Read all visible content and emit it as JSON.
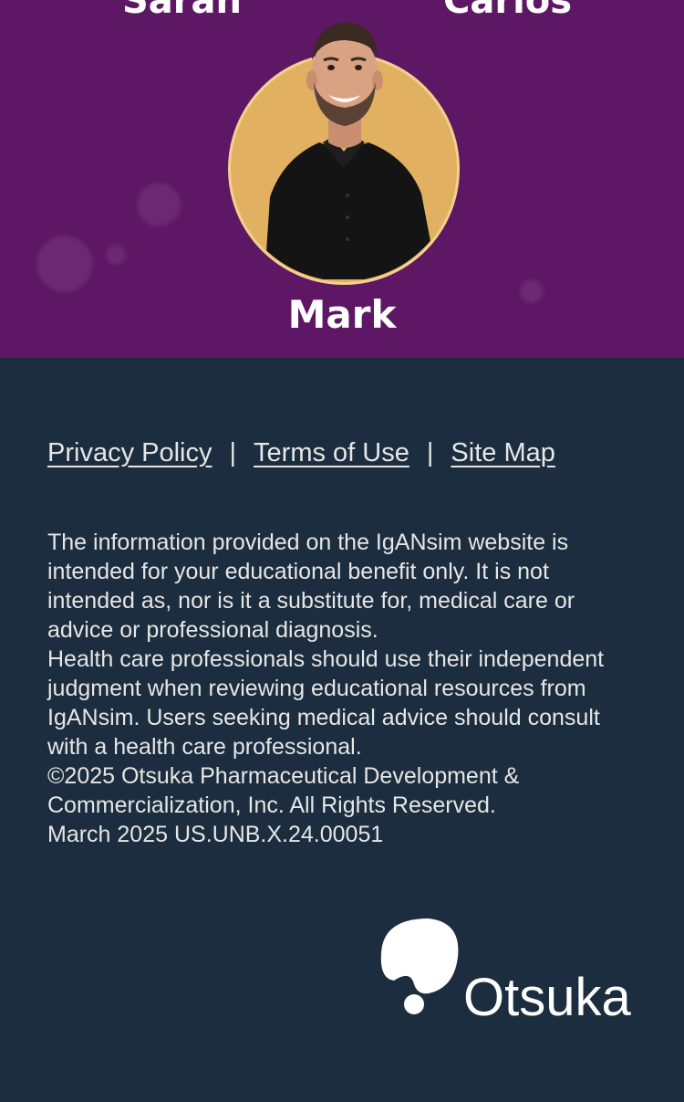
{
  "hero": {
    "top_names": [
      "Sarah",
      "Carlos"
    ],
    "featured_name": "Mark",
    "background_color": "#5e1764",
    "avatar_ring_color": "#e1b161"
  },
  "footer": {
    "background_color": "#1b2d3e",
    "links": [
      "Privacy Policy",
      "Terms of Use",
      "Site Map"
    ],
    "separator": "|",
    "disclaimer": [
      "The information provided on the IgANsim website is intended for your educational benefit only. It is not intended as, nor is it a substitute for, medical care or advice or professional diagnosis.",
      "Health care professionals should use their independent judgment when reviewing educational resources from IgANsim. Users seeking medical advice should consult with a health care professional.",
      "©2025 Otsuka Pharmaceutical Development & Commercialization, Inc. All Rights Reserved.",
      "March 2025 US.UNB.X.24.00051"
    ],
    "logo_text": "Otsuka"
  }
}
